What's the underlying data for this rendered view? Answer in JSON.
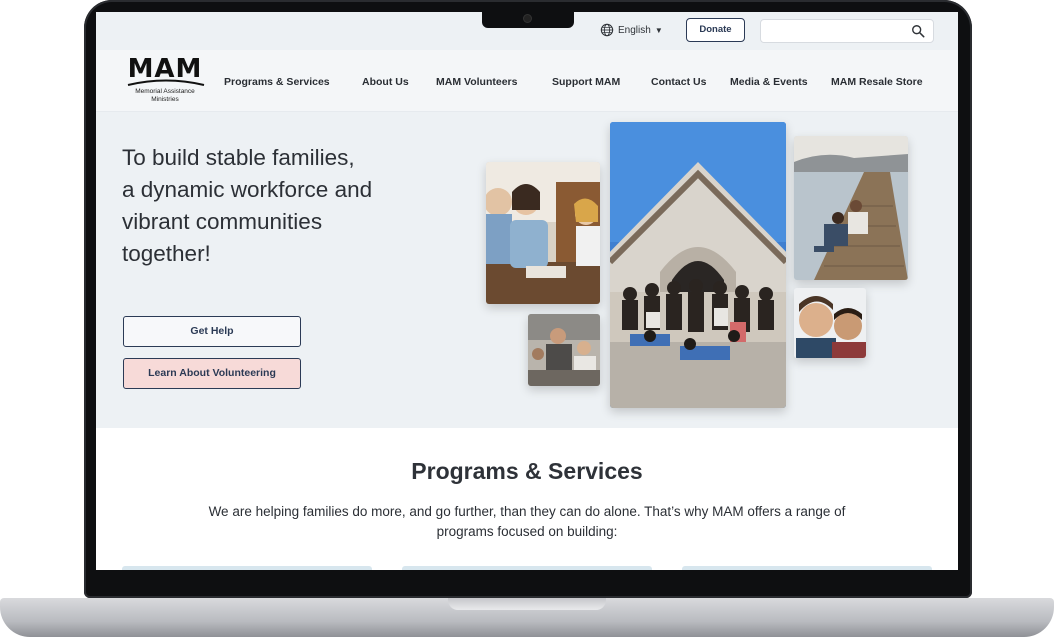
{
  "utility": {
    "language": "English",
    "donate_label": "Donate",
    "search_placeholder": ""
  },
  "logo": {
    "mark": "MAM",
    "subtitle_line1": "Memorial Assistance",
    "subtitle_line2": "Ministries"
  },
  "nav": {
    "items": [
      {
        "label": "Programs & Services"
      },
      {
        "label": "About Us"
      },
      {
        "label": "MAM Volunteers"
      },
      {
        "label": "Support MAM"
      },
      {
        "label": "Contact Us"
      },
      {
        "label": "Media & Events"
      },
      {
        "label": "MAM Resale Store"
      }
    ]
  },
  "hero": {
    "lines": [
      "To build stable families,",
      "a dynamic workforce and",
      "vibrant communities",
      "together!"
    ],
    "get_help_label": "Get Help",
    "volunteer_label": "Learn About Volunteering"
  },
  "programs": {
    "title": "Programs & Services",
    "description": "We are helping families do more, and go further, than they can do alone. That’s why MAM offers a range of programs focused on building:"
  },
  "colors": {
    "accent_navy": "#2b3a55",
    "volunteer_pink": "#f7dad8",
    "hero_bg": "#edf1f4"
  },
  "icons": [
    "globe-icon",
    "caret-down-icon",
    "search-icon"
  ]
}
